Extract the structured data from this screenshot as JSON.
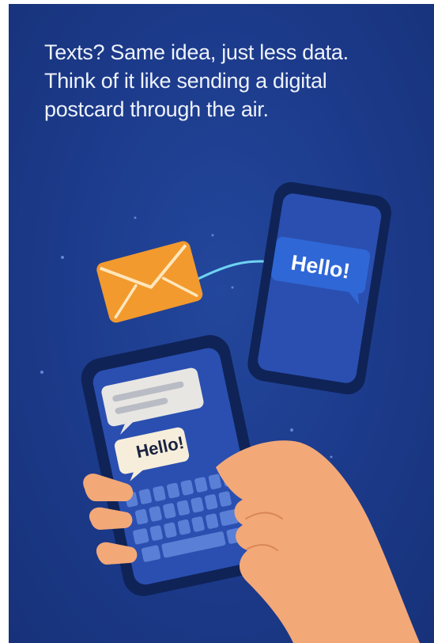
{
  "caption": {
    "lines": [
      "Texts? Same idea, just less data.",
      "Think of it like sending a digital",
      "postcard through the air."
    ]
  },
  "receiver_phone": {
    "bubble_text": "Hello!",
    "bubble_color": "#2f67d6"
  },
  "sender_phone": {
    "bubble_text": "Hello!",
    "bubble_color": "#f6eedb"
  },
  "icons": {
    "envelope": "envelope-icon",
    "transmission": "signal-arc"
  },
  "colors": {
    "background": "#1c3a8a",
    "envelope": "#f29a2e",
    "hand": "#f3a878",
    "phone_body": "#0f2357",
    "screen": "#2a4fb0"
  }
}
